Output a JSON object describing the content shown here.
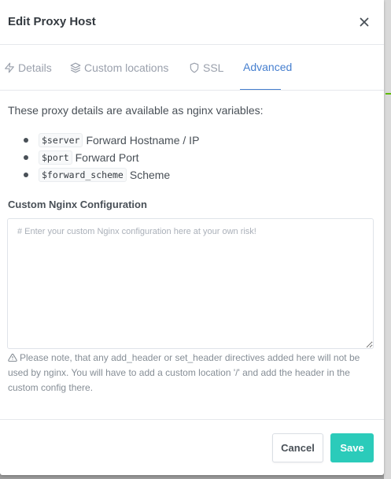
{
  "modal": {
    "title": "Edit Proxy Host",
    "close_label": "×"
  },
  "tabs": [
    {
      "label": "Details",
      "icon": "zap-icon",
      "active": false
    },
    {
      "label": "Custom locations",
      "icon": "layers-icon",
      "active": false
    },
    {
      "label": "SSL",
      "icon": "shield-icon",
      "active": false
    },
    {
      "label": "Advanced",
      "icon": "gear-icon",
      "active": true
    }
  ],
  "advanced": {
    "intro": "These proxy details are available as nginx variables:",
    "variables": [
      {
        "code": "$server",
        "description": "Forward Hostname / IP"
      },
      {
        "code": "$port",
        "description": "Forward Port"
      },
      {
        "code": "$forward_scheme",
        "description": "Scheme"
      }
    ],
    "config_label": "Custom Nginx Configuration",
    "config_value": "",
    "config_placeholder": "# Enter your custom Nginx configuration here at your own risk!",
    "note": "Please note, that any add_header or set_header directives added here will not be used by nginx. You will have to add a custom location '/' and add the header in the custom config there.",
    "note_icon": "alert-triangle-icon"
  },
  "footer": {
    "cancel_label": "Cancel",
    "save_label": "Save"
  },
  "colors": {
    "accent": "#467fcf",
    "save": "#2bcbba",
    "muted": "#9aa0ac"
  }
}
